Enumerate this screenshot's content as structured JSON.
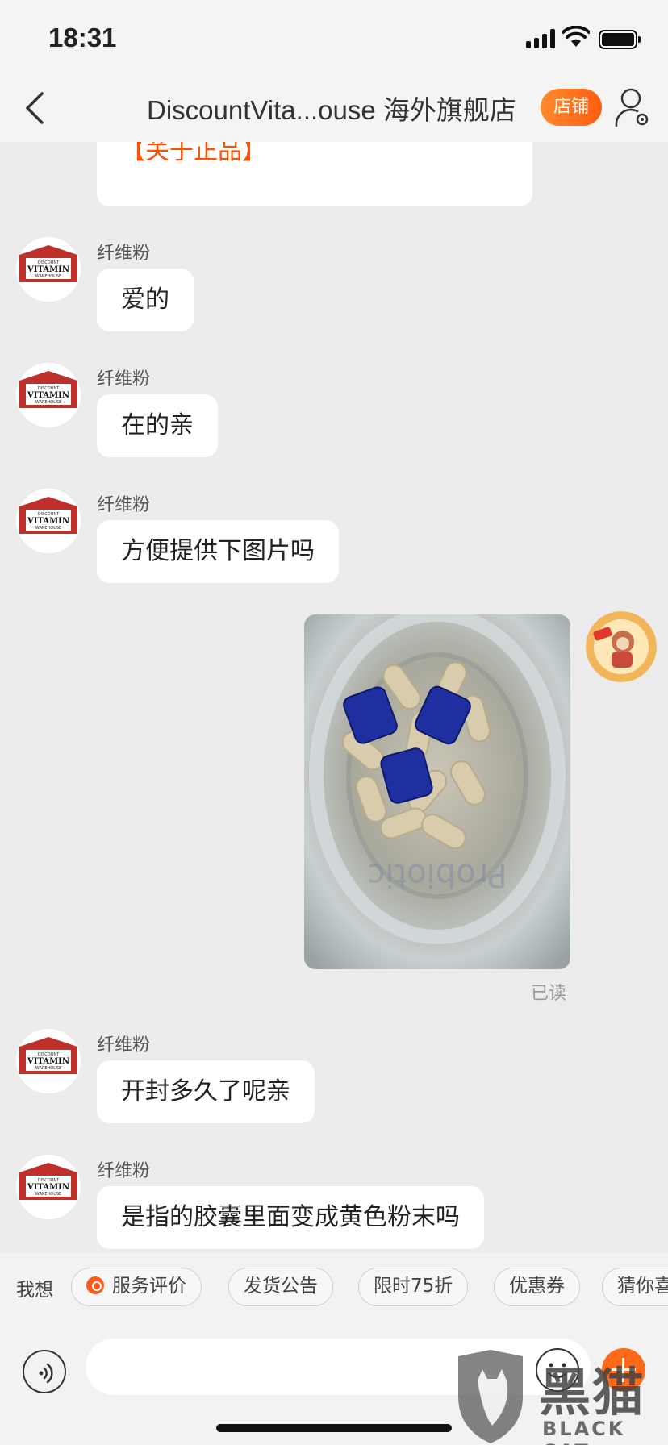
{
  "status_bar": {
    "time": "18:31"
  },
  "header": {
    "title": "DiscountVita...ouse 海外旗舰店",
    "shop_button": "店铺"
  },
  "messages": [
    {
      "text": "【关于正品】"
    },
    {
      "sender": "纤维粉",
      "text": "爱的"
    },
    {
      "sender": "纤维粉",
      "text": "在的亲"
    },
    {
      "sender": "纤维粉",
      "text": "方便提供下图片吗"
    },
    {
      "sender": "纤维粉",
      "text": "开封多久了呢亲"
    },
    {
      "sender": "纤维粉",
      "text": "是指的胶囊里面变成黄色粉末吗"
    }
  ],
  "read_status": "已读",
  "avatar_logo": {
    "line1": "DISCOUNT",
    "line2": "VITAMIN",
    "line3": "WAREHOUSE"
  },
  "quick_bar": {
    "label": "我想",
    "chips": [
      "服务评价",
      "发货公告",
      "限时75折",
      "优惠券",
      "猜你喜"
    ]
  },
  "input": {
    "placeholder": ""
  },
  "watermark": {
    "title": "黑猫",
    "subtitle": "BLACK CAT"
  },
  "colors": {
    "accent": "#ff5000",
    "background": "#ececec",
    "capsule_lid": "#1f2fa0"
  }
}
